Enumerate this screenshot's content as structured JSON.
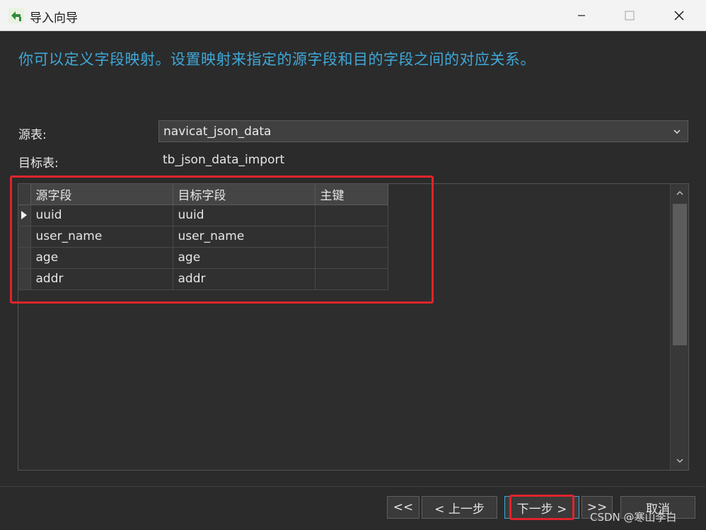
{
  "window": {
    "title": "导入向导",
    "icon": "import-wizard-icon"
  },
  "header": {
    "text": "你可以定义字段映射。设置映射来指定的源字段和目的字段之间的对应关系。"
  },
  "source": {
    "label": "源表:",
    "value": "navicat_json_data"
  },
  "target": {
    "label": "目标表:",
    "value": "tb_json_data_import"
  },
  "table": {
    "headers": [
      "源字段",
      "目标字段",
      "主键"
    ],
    "rows": [
      {
        "source": "uuid",
        "target": "uuid",
        "pk": ""
      },
      {
        "source": "user_name",
        "target": "user_name",
        "pk": ""
      },
      {
        "source": "age",
        "target": "age",
        "pk": ""
      },
      {
        "source": "addr",
        "target": "addr",
        "pk": ""
      }
    ]
  },
  "buttons": {
    "first": "<<",
    "prev": "< 上一步",
    "next": "下一步 >",
    "last": ">>",
    "cancel": "取消"
  },
  "watermark": "CSDN @寒山李白",
  "colors": {
    "accent": "#3fa8d8",
    "highlight": "#e0242b",
    "background": "#2b2b2b"
  }
}
